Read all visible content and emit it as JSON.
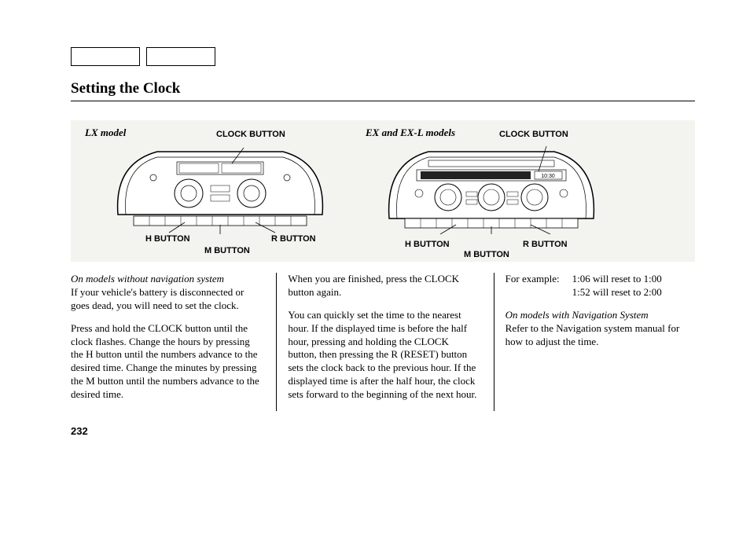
{
  "section_title": "Setting the Clock",
  "diagram": {
    "lx_label": "LX model",
    "ex_label": "EX and EX-L models",
    "clock_button": "CLOCK BUTTON",
    "h_button": "H BUTTON",
    "m_button": "M BUTTON",
    "r_button": "R BUTTON"
  },
  "col1": {
    "p1_italic": "On models without navigation system",
    "p1_rest": "If your vehicle's battery is disconnected or goes dead, you will need to set the clock.",
    "p2": "Press and hold the CLOCK button until the clock flashes. Change the hours by pressing the H button until the numbers advance to the desired time. Change the minutes by pressing the M button until the numbers advance to the desired time."
  },
  "col2": {
    "p1": "When you are finished, press the CLOCK button again.",
    "p2": "You can quickly set the time to the nearest hour. If the displayed time is before the half hour, pressing and holding the CLOCK button, then pressing the R (RESET) button sets the clock back to the previous hour. If the displayed time is after the half hour, the clock sets forward to the beginning of the next hour."
  },
  "col3": {
    "example_label": "For example:",
    "example_1": "1:06 will reset to 1:00",
    "example_2": "1:52 will reset to 2:00",
    "p2_italic": "On models with Navigation System",
    "p2_rest": "Refer to the Navigation system manual for how to adjust the time."
  },
  "page_number": "232"
}
